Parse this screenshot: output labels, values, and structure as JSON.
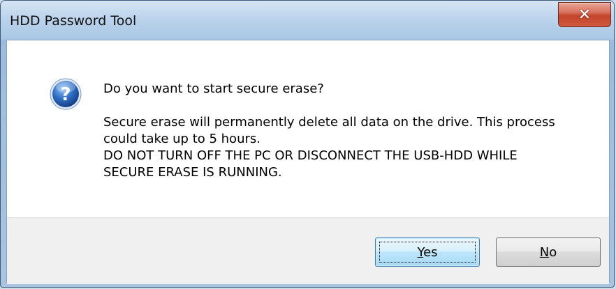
{
  "window": {
    "title": "HDD Password Tool",
    "close_symbol": "✕"
  },
  "dialog": {
    "icon": "question-icon",
    "question": "Do you want to start secure erase?",
    "body_lines": [
      "Secure erase will permanently delete all data on the drive.  This process",
      "could take up to 5 hours.",
      "DO NOT TURN OFF THE PC OR DISCONNECT THE USB-HDD WHILE",
      "SECURE ERASE IS RUNNING."
    ]
  },
  "buttons": {
    "yes": {
      "mnemonic": "Y",
      "rest": "es"
    },
    "no": {
      "mnemonic": "N",
      "rest": "o"
    }
  },
  "colors": {
    "titlebar": "#bcd4ec",
    "close_button": "#c3452c",
    "icon_blue": "#2c64b6"
  }
}
